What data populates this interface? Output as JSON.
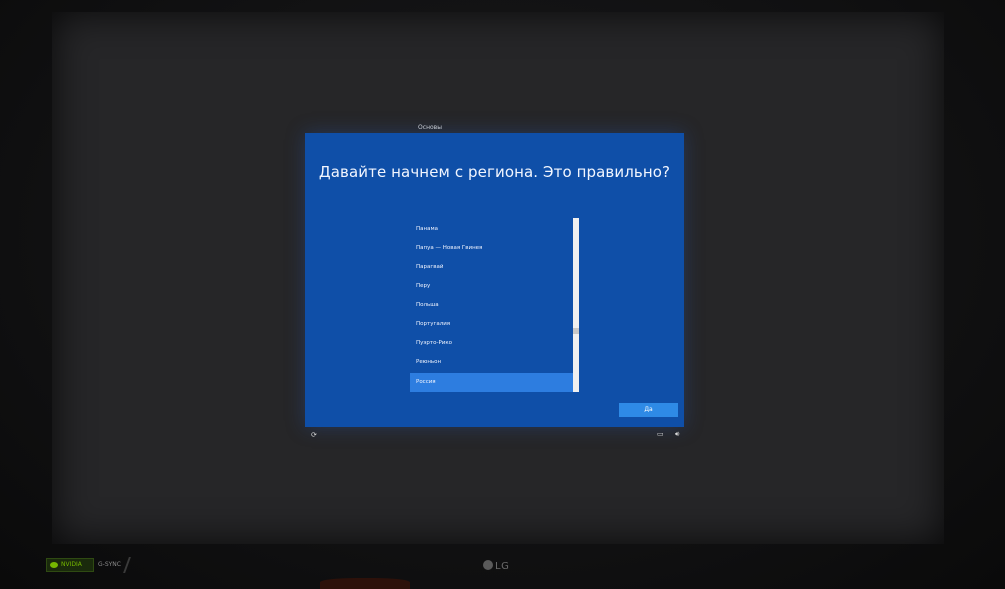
{
  "setup": {
    "step_label": "Основы",
    "title": "Давайте начнем с региона. Это правильно?",
    "regions": [
      {
        "label": "Панама",
        "selected": false
      },
      {
        "label": "Папуа — Новая Гвинея",
        "selected": false
      },
      {
        "label": "Парагвай",
        "selected": false
      },
      {
        "label": "Перу",
        "selected": false
      },
      {
        "label": "Польша",
        "selected": false
      },
      {
        "label": "Португалия",
        "selected": false
      },
      {
        "label": "Пуэрто-Рико",
        "selected": false
      },
      {
        "label": "Реюньон",
        "selected": false
      },
      {
        "label": "Россия",
        "selected": true
      }
    ],
    "yes_button": "Да"
  },
  "taskbar": {
    "accessibility_icon": "accessibility-icon",
    "keyboard_icon": "keyboard-icon",
    "volume_icon": "volume-icon"
  },
  "bezel": {
    "nvidia": "NVIDIA",
    "gsync": "G-SYNC",
    "brand": "LG"
  },
  "colors": {
    "panel_blue": "#0f4fa8",
    "selected_blue": "#2d7de0",
    "button_blue": "#2e8ae6",
    "nvidia_green": "#76b900"
  }
}
